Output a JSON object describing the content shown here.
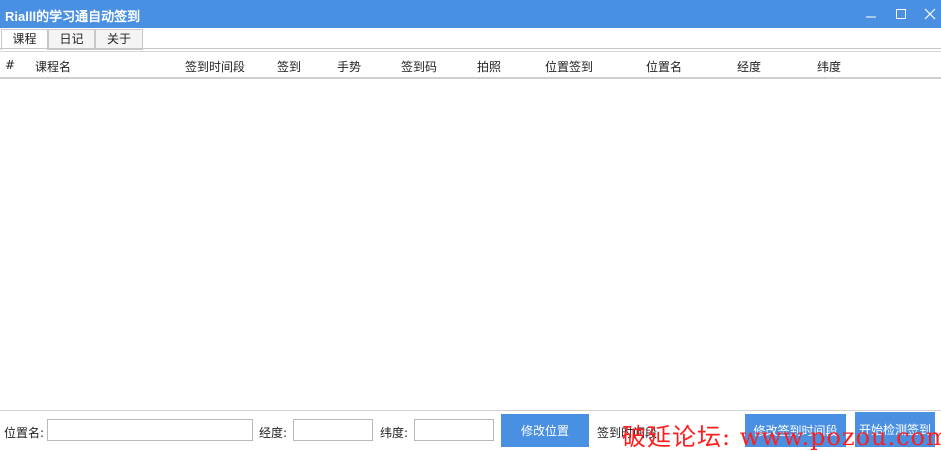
{
  "window": {
    "title": "Rialll的学习通自动签到",
    "controls": [
      "minimize-icon",
      "maximize-icon",
      "close-icon"
    ]
  },
  "tabs": [
    {
      "label": "课程",
      "active": true
    },
    {
      "label": "日记",
      "active": false
    },
    {
      "label": "关于",
      "active": false
    }
  ],
  "table": {
    "columns": [
      "#",
      "课程名",
      "签到时间段",
      "签到",
      "手势",
      "签到码",
      "拍照",
      "位置签到",
      "位置名",
      "经度",
      "纬度"
    ],
    "rows": []
  },
  "bottom": {
    "location_label": "位置名:",
    "longitude_label": "经度:",
    "latitude_label": "纬度:",
    "location_value": "",
    "longitude_value": "",
    "latitude_value": "",
    "modify_location_button": "修改位置",
    "time_label": "签到时间段",
    "modify_time_button": "修改签到时间段",
    "start_button": "开始检测签到"
  },
  "watermark": {
    "text": "破延论坛: www.pozou.com",
    "color": "#ff1e1e"
  },
  "colors": {
    "accent": "#4a90e2"
  }
}
